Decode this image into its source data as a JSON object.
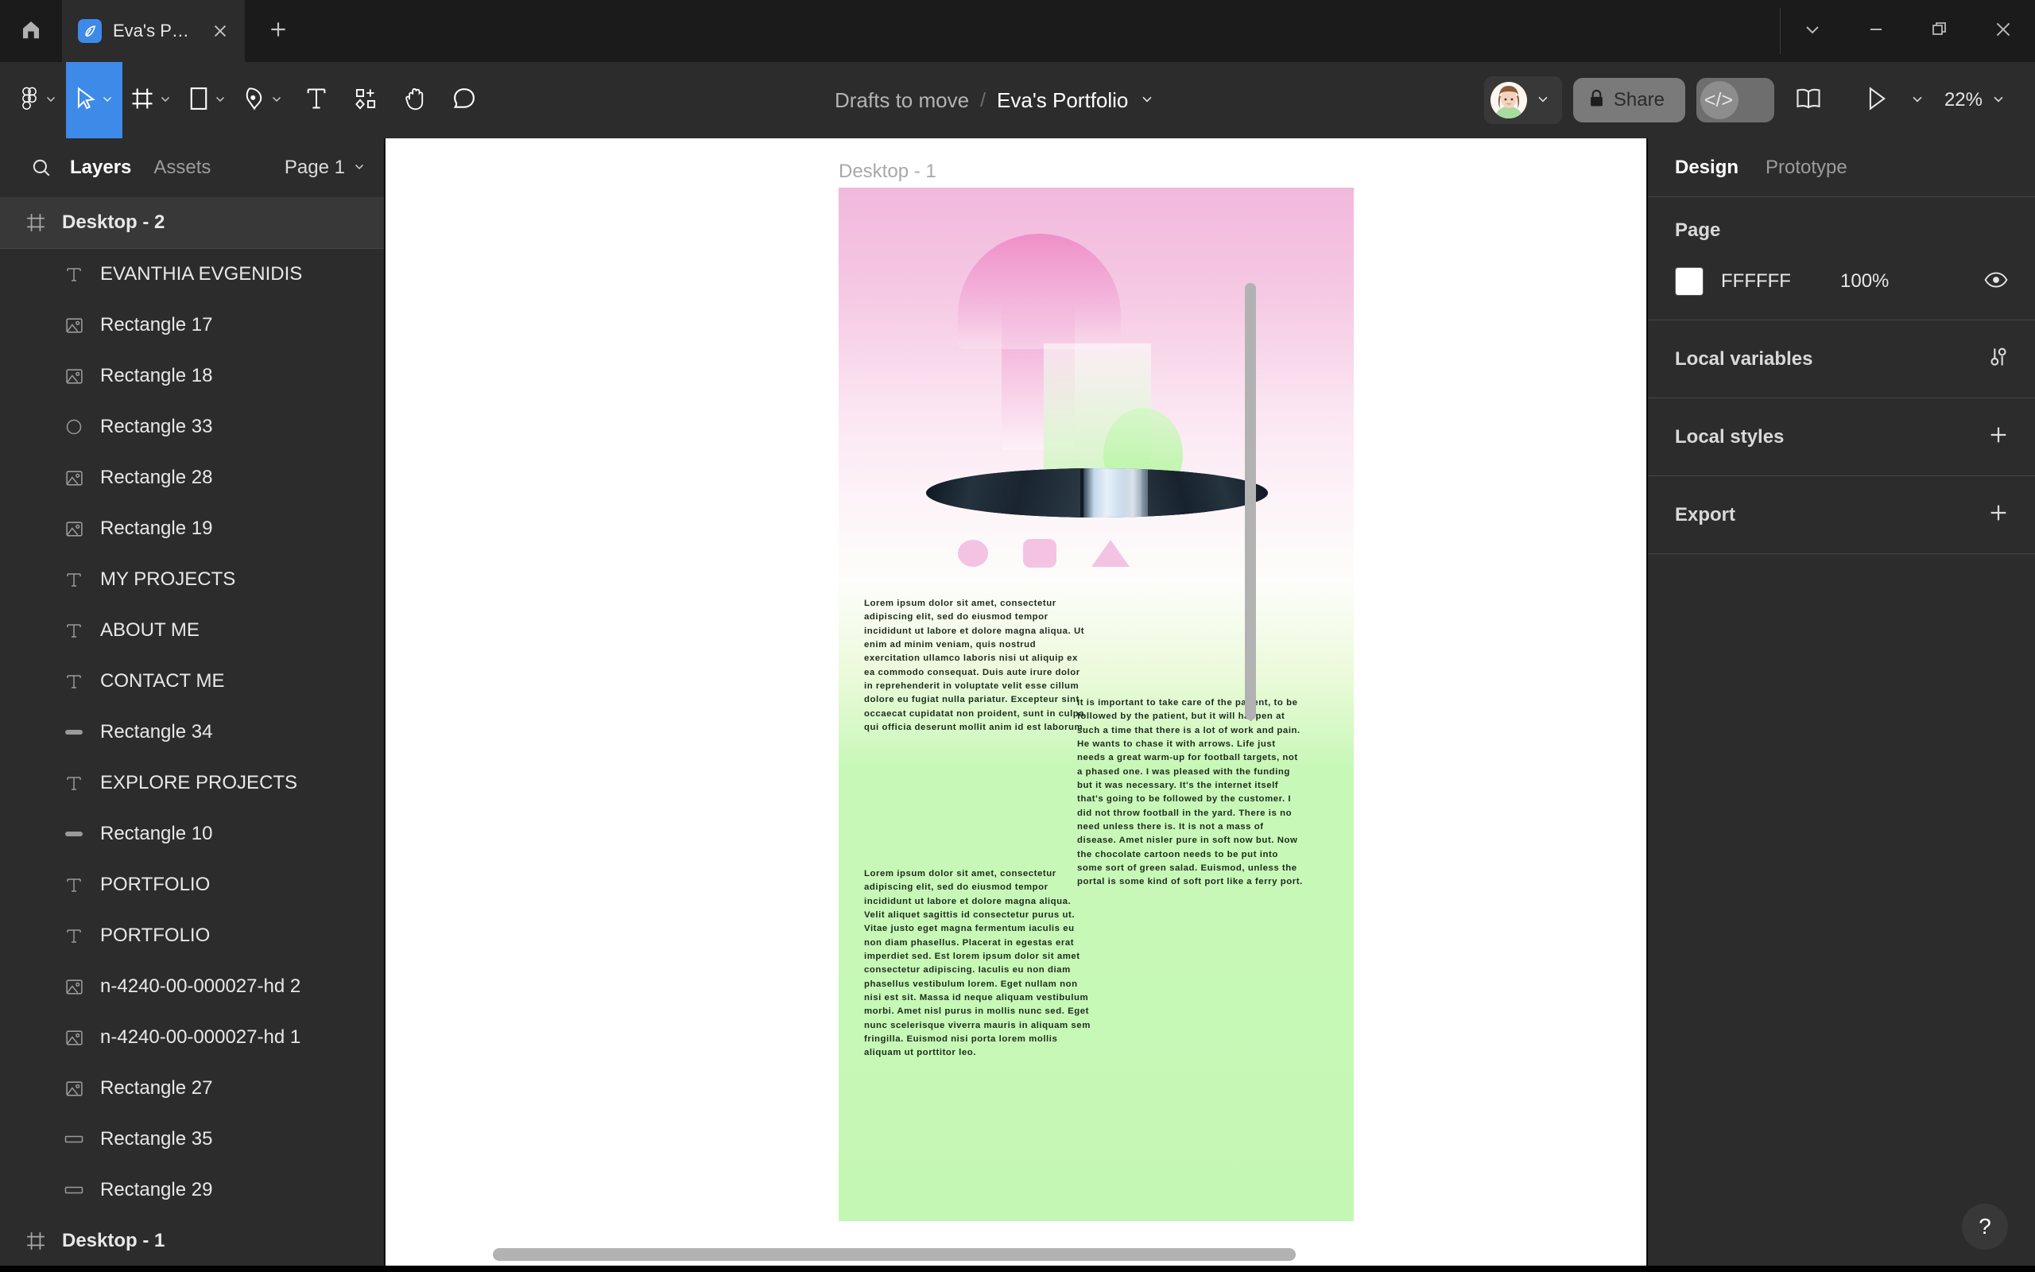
{
  "window": {
    "home_icon": "home-icon",
    "tab": {
      "title": "Eva's Portfolio",
      "favicon": "figma-file-icon",
      "close_icon": "close-icon"
    },
    "new_tab_icon": "plus-icon",
    "controls": {
      "chevron": "chevron-down-icon",
      "minimize": "minimize-icon",
      "restore": "restore-icon",
      "close": "close-icon"
    }
  },
  "toolbar": {
    "tools": [
      {
        "name": "figma-menu-icon",
        "glyph": "figma-logo",
        "caret": true,
        "active": false
      },
      {
        "name": "move-tool-icon",
        "glyph": "cursor",
        "caret": true,
        "active": true
      },
      {
        "name": "frame-tool-icon",
        "glyph": "frame",
        "caret": true,
        "active": false
      },
      {
        "name": "shape-tool-icon",
        "glyph": "rectangle",
        "caret": true,
        "active": false
      },
      {
        "name": "pen-tool-icon",
        "glyph": "pen",
        "caret": true,
        "active": false
      },
      {
        "name": "text-tool-icon",
        "glyph": "text",
        "caret": false,
        "active": false
      },
      {
        "name": "resources-tool-icon",
        "glyph": "components",
        "caret": false,
        "active": false
      },
      {
        "name": "hand-tool-icon",
        "glyph": "hand",
        "caret": false,
        "active": false
      },
      {
        "name": "comment-tool-icon",
        "glyph": "comment",
        "caret": false,
        "active": false
      }
    ],
    "breadcrumb": {
      "parent": "Drafts to move",
      "separator": "/",
      "current": "Eva's Portfolio",
      "caret_icon": "chevron-down-icon"
    },
    "avatar_name": "avatar",
    "avatar_caret": "chevron-down-icon",
    "share_label": "Share",
    "share_lock_icon": "lock-icon",
    "devmode_glyph": "</>",
    "book_icon": "book-icon",
    "present_icon": "play-icon",
    "present_caret": "chevron-down-icon",
    "zoom_label": "22%",
    "zoom_caret": "chevron-down-icon"
  },
  "left_panel": {
    "search_icon": "search-icon",
    "tabs": [
      {
        "label": "Layers",
        "active": true
      },
      {
        "label": "Assets",
        "active": false
      }
    ],
    "page_selector": {
      "label": "Page 1",
      "caret_icon": "chevron-down-icon"
    },
    "layers": [
      {
        "name": "Desktop - 2",
        "icon": "frame-icon",
        "kind": "frame",
        "selected": true
      },
      {
        "name": "EVANTHIA EVGENIDIS",
        "icon": "text-layer-icon",
        "kind": "child"
      },
      {
        "name": "Rectangle 17",
        "icon": "image-layer-icon",
        "kind": "child"
      },
      {
        "name": "Rectangle 18",
        "icon": "image-layer-icon",
        "kind": "child"
      },
      {
        "name": "Rectangle 33",
        "icon": "ellipse-layer-icon",
        "kind": "child"
      },
      {
        "name": "Rectangle 28",
        "icon": "image-layer-icon",
        "kind": "child"
      },
      {
        "name": "Rectangle 19",
        "icon": "image-layer-icon",
        "kind": "child"
      },
      {
        "name": "MY PROJECTS",
        "icon": "text-layer-icon",
        "kind": "child"
      },
      {
        "name": "ABOUT ME",
        "icon": "text-layer-icon",
        "kind": "child"
      },
      {
        "name": "CONTACT ME",
        "icon": "text-layer-icon",
        "kind": "child"
      },
      {
        "name": "Rectangle 34",
        "icon": "rounded-bar-layer-icon",
        "kind": "child"
      },
      {
        "name": "EXPLORE PROJECTS",
        "icon": "text-layer-icon",
        "kind": "child"
      },
      {
        "name": "Rectangle 10",
        "icon": "rounded-bar-layer-icon",
        "kind": "child"
      },
      {
        "name": "PORTFOLIO",
        "icon": "text-layer-icon",
        "kind": "child"
      },
      {
        "name": "PORTFOLIO",
        "icon": "text-layer-icon",
        "kind": "child"
      },
      {
        "name": "n-4240-00-000027-hd 2",
        "icon": "image-layer-icon",
        "kind": "child"
      },
      {
        "name": "n-4240-00-000027-hd 1",
        "icon": "image-layer-icon",
        "kind": "child"
      },
      {
        "name": "Rectangle 27",
        "icon": "image-layer-icon",
        "kind": "child"
      },
      {
        "name": "Rectangle 35",
        "icon": "rect-layer-icon",
        "kind": "child"
      },
      {
        "name": "Rectangle 29",
        "icon": "rect-layer-icon",
        "kind": "child"
      },
      {
        "name": "Desktop - 1",
        "icon": "frame-icon",
        "kind": "frame",
        "selected": false
      }
    ]
  },
  "right_panel": {
    "tabs": [
      {
        "label": "Design",
        "active": true
      },
      {
        "label": "Prototype",
        "active": false
      }
    ],
    "page_section": {
      "title": "Page",
      "color_hex": "FFFFFF",
      "color_value": "#FFFFFF",
      "opacity": "100%",
      "visibility_icon": "eye-icon"
    },
    "rows": [
      {
        "title": "Local variables",
        "action_icon": "variables-icon"
      },
      {
        "title": "Local styles",
        "action_icon": "plus-icon"
      },
      {
        "title": "Export",
        "action_icon": "plus-icon"
      }
    ]
  },
  "canvas": {
    "frame_label": "Desktop - 1",
    "background": "#FFFFFF",
    "artboard": {
      "gradient_top": "#F2B8DD",
      "gradient_mid": "#FDFDFB",
      "gradient_bottom": "#C5F7B4",
      "accent_pink": "#F4C3E4",
      "shapes": [
        {
          "name": "mushroom-cap-shape"
        },
        {
          "name": "mushroom-stem-shape"
        },
        {
          "name": "translucent-rectangle-shape"
        },
        {
          "name": "green-circle-shape"
        },
        {
          "name": "waterfall-photo-ellipse"
        },
        {
          "name": "pink-circle-shape"
        },
        {
          "name": "pink-rounded-square-shape"
        },
        {
          "name": "pink-triangle-shape"
        }
      ],
      "text_blocks": [
        "Lorem ipsum dolor sit amet, consectetur adipiscing elit, sed do eiusmod tempor incididunt ut labore et dolore magna aliqua. Ut enim ad minim veniam, quis nostrud exercitation ullamco laboris nisi ut aliquip ex ea commodo consequat. Duis aute irure dolor in reprehenderit in voluptate velit esse cillum dolore eu fugiat nulla pariatur. Excepteur sint occaecat cupidatat non proident, sunt in culpa qui officia deserunt mollit anim id est laborum.",
        "It is important to take care of the patient, to be followed by the patient, but it will happen at such a time that there is a lot of work and pain. He wants to chase it with arrows. Life just needs a great warm-up for football targets, not a phased one. I was pleased with the funding but it was necessary. It's the internet itself that's going to be followed by the customer. I did not throw football in the yard. There is no need unless there is. It is not a mass of disease. Amet nisler pure in soft now but. Now the chocolate cartoon needs to be put into some sort of green salad. Euismod, unless the portal is some kind of soft port like a ferry port.",
        "Lorem ipsum dolor sit amet, consectetur adipiscing elit, sed do eiusmod tempor incididunt ut labore et dolore magna aliqua. Velit aliquet sagittis id consectetur purus ut. Vitae justo eget magna fermentum iaculis eu non diam phasellus. Placerat in egestas erat imperdiet sed. Est lorem ipsum dolor sit amet consectetur adipiscing. Iaculis eu non diam phasellus vestibulum lorem. Eget nullam non nisi est sit. Massa id neque aliquam vestibulum morbi. Amet nisl purus in mollis nunc sed. Eget nunc scelerisque viverra mauris in aliquam sem fringilla. Euismod nisi porta lorem mollis aliquam ut porttitor leo."
      ]
    },
    "help_button_label": "?",
    "h_scrollbar_name": "horizontal-scrollbar",
    "v_scrollbar_name": "vertical-scrollbar"
  }
}
